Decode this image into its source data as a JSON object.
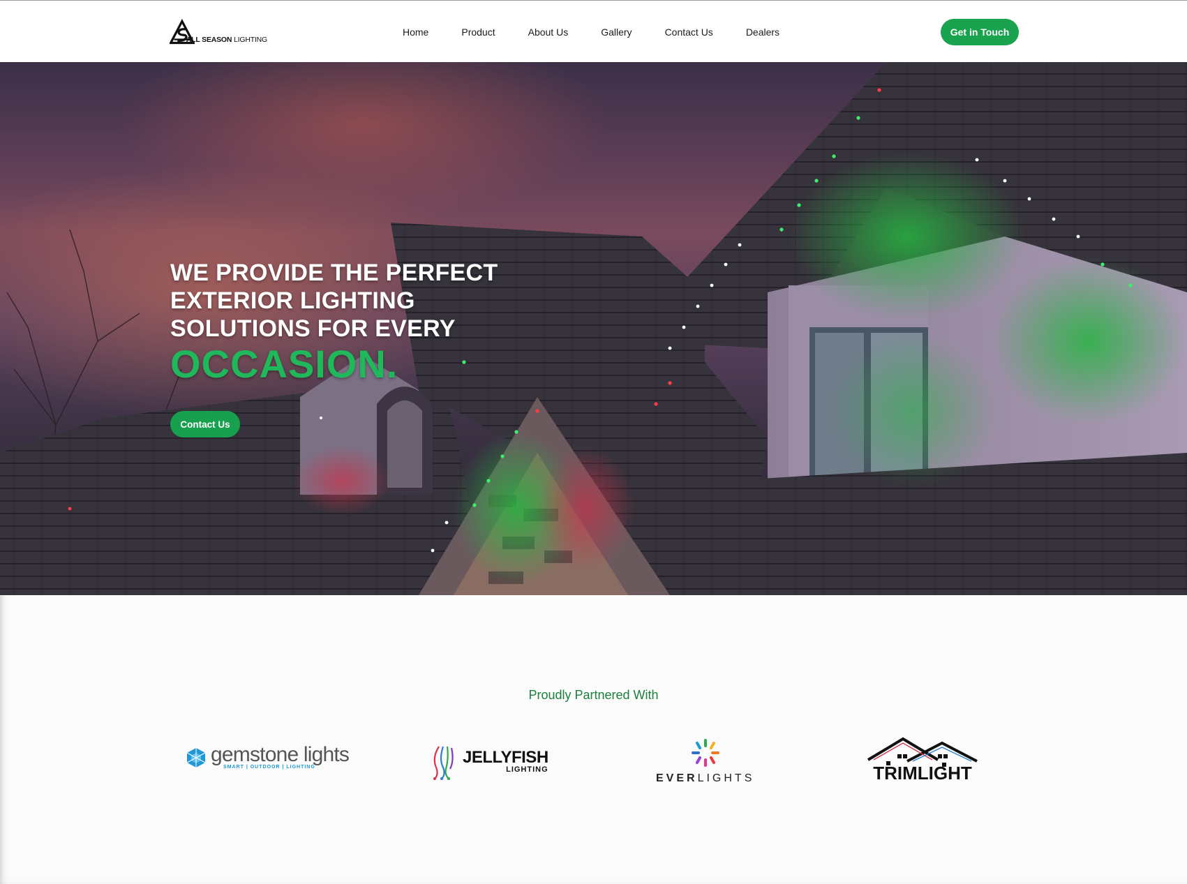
{
  "header": {
    "logo": {
      "mark": "ASL",
      "name_bold": "ALL SEASON",
      "name_light": "LIGHTING"
    },
    "nav": [
      "Home",
      "Product",
      "About Us",
      "Gallery",
      "Contact Us",
      "Dealers"
    ],
    "cta_label": "Get in Touch"
  },
  "hero": {
    "title_line1": "WE PROVIDE THE PERFECT",
    "title_line2": "EXTERIOR LIGHTING",
    "title_line3": "SOLUTIONS FOR EVERY",
    "title_accent": "OCCASION.",
    "button_label": "Contact Us"
  },
  "partners": {
    "title": "Proudly Partnered With",
    "items": [
      {
        "name": "gemstone lights",
        "tagline": "SMART | OUTDOOR | LIGHTING"
      },
      {
        "name": "JELLYFISH",
        "tagline": "LIGHTING"
      },
      {
        "name_bold": "EVER",
        "name_light": "LIGHTS"
      },
      {
        "name": "TRIMLIGHT"
      }
    ]
  },
  "colors": {
    "brand_green": "#1aa34f",
    "accent_green": "#1fb85a",
    "partners_title": "#1b7e3e"
  }
}
